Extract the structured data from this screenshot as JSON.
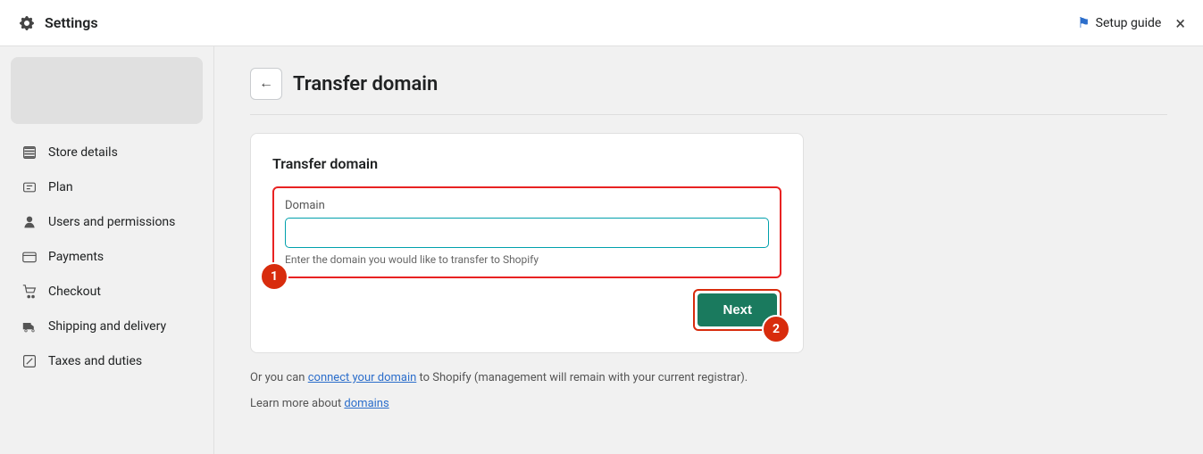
{
  "header": {
    "title": "Settings",
    "setup_guide_label": "Setup guide",
    "close_label": "×"
  },
  "sidebar": {
    "items": [
      {
        "id": "store-details",
        "label": "Store details",
        "icon": "store"
      },
      {
        "id": "plan",
        "label": "Plan",
        "icon": "plan"
      },
      {
        "id": "users-permissions",
        "label": "Users and permissions",
        "icon": "users"
      },
      {
        "id": "payments",
        "label": "Payments",
        "icon": "payments"
      },
      {
        "id": "checkout",
        "label": "Checkout",
        "icon": "checkout"
      },
      {
        "id": "shipping-delivery",
        "label": "Shipping and delivery",
        "icon": "shipping"
      },
      {
        "id": "taxes-duties",
        "label": "Taxes and duties",
        "icon": "taxes"
      }
    ]
  },
  "page": {
    "back_label": "←",
    "title": "Transfer domain",
    "divider": true
  },
  "transfer_card": {
    "title": "Transfer domain",
    "domain_label": "Domain",
    "domain_placeholder": "",
    "domain_hint": "Enter the domain you would like to transfer to Shopify",
    "step1_badge": "1",
    "next_button_label": "Next",
    "step2_badge": "2"
  },
  "footer": {
    "prefix": "Or you can ",
    "link_text": "connect your domain",
    "suffix": " to Shopify (management will remain with your current registrar).",
    "learn_prefix": "Learn more about ",
    "learn_link": "domains"
  }
}
